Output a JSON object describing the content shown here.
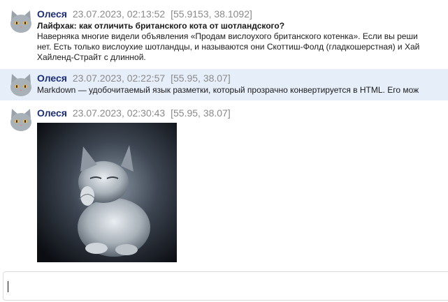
{
  "messages": [
    {
      "author": "Олеся",
      "timestamp": "23.07.2023, 02:13:52",
      "coords": "[55.9153, 38.1092]",
      "title": "Лайфхак: как отличить британского кота от шотландского?",
      "lines": [
        "Наверняка многие видели объявления «Продам вислоухого британского котенка». Если вы реши",
        "нет. Есть только вислоухие шотландцы, и называются они Скоттиш-Фолд (гладкошерстная) и Хай",
        "Хайленд-Страйт с длинной."
      ]
    },
    {
      "author": "Олеся",
      "timestamp": "23.07.2023, 02:22:57",
      "coords": "[55.95, 38.07]",
      "lines": [
        "Markdown — удобочитаемый язык разметки, который прозрачно конвертируется в HTML. Его мож"
      ]
    },
    {
      "author": "Олеся",
      "timestamp": "23.07.2023, 02:30:43",
      "coords": "[55.95, 38.07]",
      "image": "kitten-photo"
    }
  ],
  "composer": {
    "value": "",
    "placeholder": ""
  },
  "icons": {
    "avatar": "gray-cat-avatar-icon"
  }
}
